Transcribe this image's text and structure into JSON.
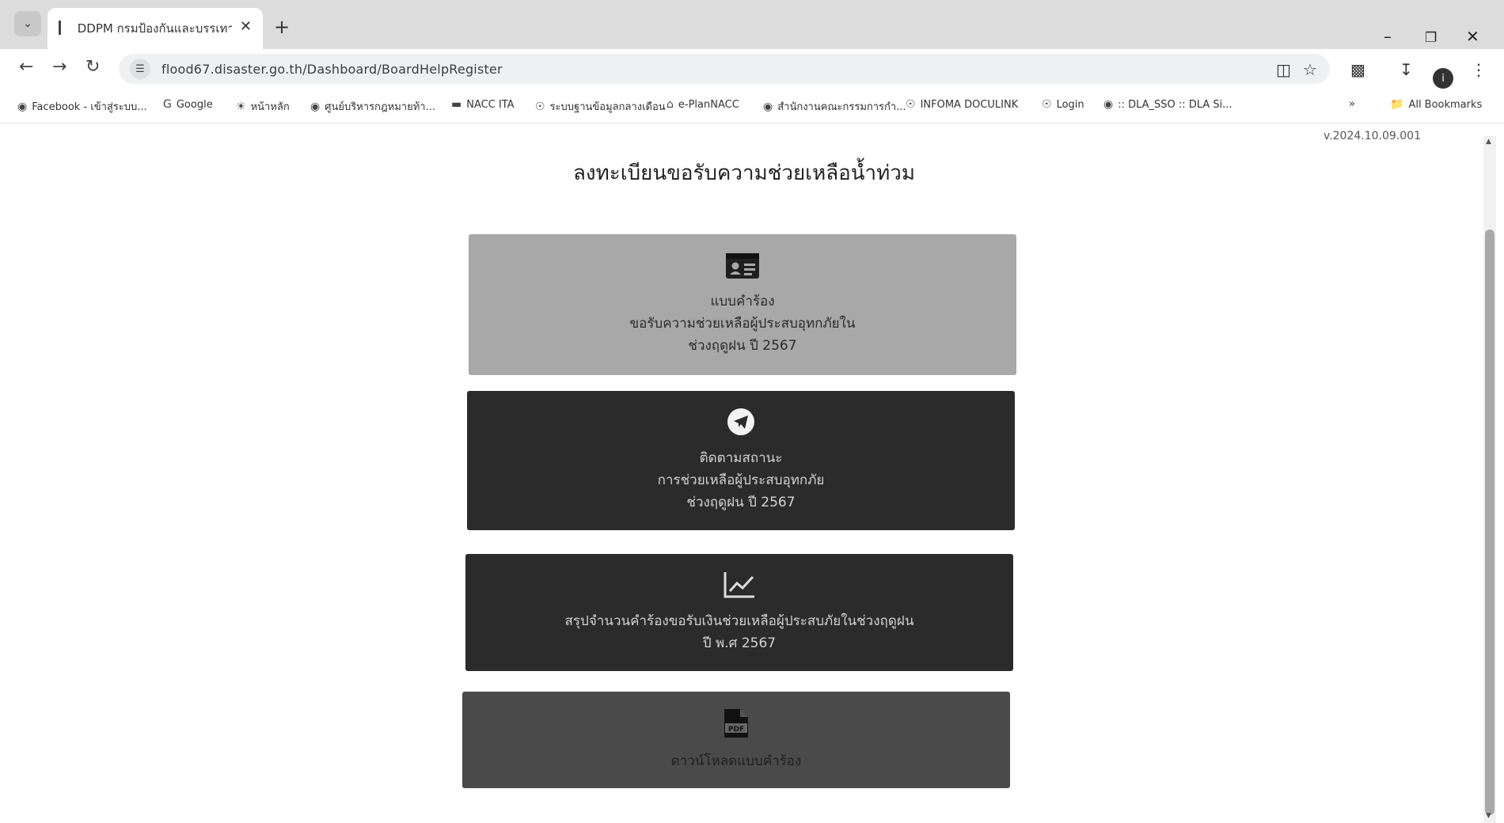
{
  "browser": {
    "tab_title": "DDPM กรมป้องกันและบรรเทาสาธา",
    "url": "flood67.disaster.go.th/Dashboard/BoardHelpRegister",
    "profile_initial": "i",
    "bookmarks": [
      "Facebook - เข้าสู่ระบบ...",
      "Google",
      "หน้าหลัก",
      "ศูนย์บริหารกฎหมายท้า...",
      "NACC ITA",
      "ระบบฐานข้อมูลกลางเดือน",
      "e-PlanNACC",
      "สำนักงานคณะกรรมการกำ...",
      "INFOMA DOCULINK",
      "Login",
      ":: DLA_SSO :: DLA Si..."
    ],
    "more_bookmarks": "»",
    "all_bookmarks": "All Bookmarks"
  },
  "page": {
    "version": "v.2024.10.09.001",
    "title": "ลงทะเบียนขอรับความช่วยเหลือน้ำท่วม"
  },
  "cards": [
    {
      "icon": "id-card-icon",
      "lines": [
        "แบบคำร้อง",
        "ขอรับความช่วยเหลือผู้ประสบอุทกภัยใน",
        "ช่วงฤดูฝน ปี 2567"
      ]
    },
    {
      "icon": "telegram-icon",
      "lines": [
        "ติดตามสถานะ",
        "การช่วยเหลือผู้ประสบอุทกภัย",
        "ช่วงฤดูฝน ปี 2567"
      ]
    },
    {
      "icon": "line-chart-icon",
      "lines": [
        "สรุปจำนวนคำร้องขอรับเงินช่วยเหลือผู้ประสบภัยในช่วงฤดูฝน",
        "ปี พ.ศ 2567"
      ]
    },
    {
      "icon": "pdf-file-icon",
      "lines": [
        "ดาวน์โหลดแบบคำร้อง"
      ]
    }
  ]
}
